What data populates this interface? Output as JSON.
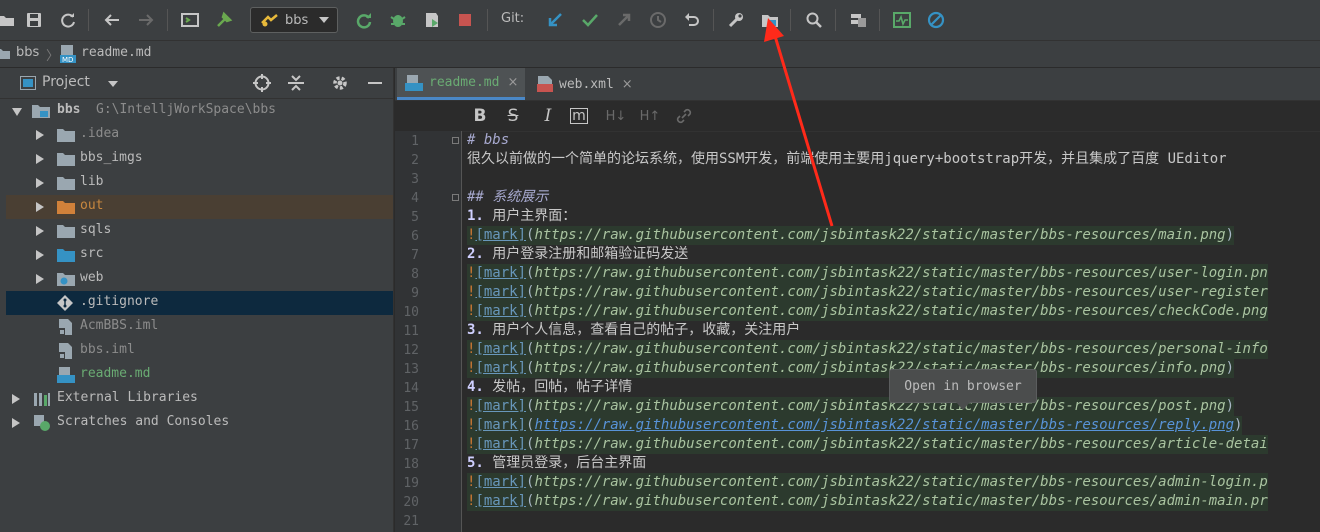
{
  "toolbar": {
    "run_config": "bbs",
    "git_label": "Git:",
    "icons": [
      "open-icon",
      "save-icon",
      "sync-icon",
      "back-icon",
      "forward-icon",
      "terminal-icon",
      "build-icon",
      "run-config-icon",
      "rerun-icon",
      "debug-icon",
      "coverage-icon",
      "stop-icon",
      "git-update-icon",
      "git-commit-icon",
      "git-push-icon",
      "git-history-icon",
      "git-revert-icon",
      "settings-wrench-icon",
      "project-structure-icon",
      "search-icon",
      "sdk-icon",
      "monitor-icon",
      "no-entry-icon"
    ]
  },
  "breadcrumb": {
    "project": "bbs",
    "file": "readme.md",
    "separator": "〉"
  },
  "project_panel": {
    "title": "Project",
    "tree": [
      {
        "label": "bbs",
        "path": "G:\\IntelljWorkSpace\\bbs",
        "expanded": true
      },
      {
        "label": ".idea"
      },
      {
        "label": "bbs_imgs"
      },
      {
        "label": "lib"
      },
      {
        "label": "out"
      },
      {
        "label": "sqls"
      },
      {
        "label": "src"
      },
      {
        "label": "web"
      },
      {
        "label": ".gitignore",
        "selected": true
      },
      {
        "label": "AcmBBS.iml"
      },
      {
        "label": "bbs.iml"
      },
      {
        "label": "readme.md"
      },
      {
        "label": "External Libraries"
      },
      {
        "label": "Scratches and Consoles"
      }
    ]
  },
  "tabs": [
    {
      "label": "readme.md",
      "active": true,
      "close": "×"
    },
    {
      "label": "web.xml",
      "active": false,
      "close": "×"
    }
  ],
  "md_toolbar": [
    "B",
    "S",
    "I",
    "m",
    "H↓",
    "H↑",
    "link"
  ],
  "editor": {
    "line_numbers": [
      "1",
      "2",
      "3",
      "4",
      "5",
      "6",
      "7",
      "8",
      "9",
      "10",
      "11",
      "12",
      "13",
      "14",
      "15",
      "16",
      "17",
      "18",
      "19",
      "20",
      "21"
    ],
    "lines": {
      "l1": "# bbs",
      "l2": "很久以前做的一个简单的论坛系统，使用SSM开发，前端使用主要用jquery+bootstrap开发，并且集成了百度 UEditor",
      "l4": "## 系统展示",
      "l5_num": "1.",
      "l5_text": " 用户主界面：",
      "l7_num": "2.",
      "l7_text": " 用户登录注册和邮箱验证码发送",
      "l11_num": "3.",
      "l11_text": " 用户个人信息，查看自己的帖子，收藏，关注用户",
      "l14_num": "4.",
      "l14_text": " 发帖，回帖，帖子详情",
      "l18_num": "5.",
      "l18_text": " 管理员登录，后台主界面",
      "bang": "!",
      "mark": "[mark]",
      "open_paren": "(",
      "close_paren": ")",
      "u6": "https://raw.githubusercontent.com/jsbintask22/static/master/bbs-resources/main.png",
      "u8": "https://raw.githubusercontent.com/jsbintask22/static/master/bbs-resources/user-login.pn",
      "u9": "https://raw.githubusercontent.com/jsbintask22/static/master/bbs-resources/user-register",
      "u10": "https://raw.githubusercontent.com/jsbintask22/static/master/bbs-resources/checkCode.png",
      "u12": "https://raw.githubusercontent.com/jsbintask22/static/master/bbs-resources/personal-info",
      "u13": "https://raw.githubusercontent.com/jsbintask22/static/master/bbs-resources/info.png",
      "u15": "https://raw.githubusercontent.com/jsbintask22/static/master/bbs-resources/post.png",
      "u16": "https://raw.githubusercontent.com/jsbintask22/static/master/bbs-resources/reply.png",
      "u17": "https://raw.githubusercontent.com/jsbintask22/static/master/bbs-resources/article-detai",
      "u19": "https://raw.githubusercontent.com/jsbintask22/static/master/bbs-resources/admin-login.p",
      "u20": "https://raw.githubusercontent.com/jsbintask22/static/master/bbs-resources/admin-main.pr"
    }
  },
  "tooltip": "Open in browser",
  "colors": {
    "annotation_arrow": "#ff2a1a",
    "accent": "#4a88c7",
    "selection": "#0d293e"
  }
}
